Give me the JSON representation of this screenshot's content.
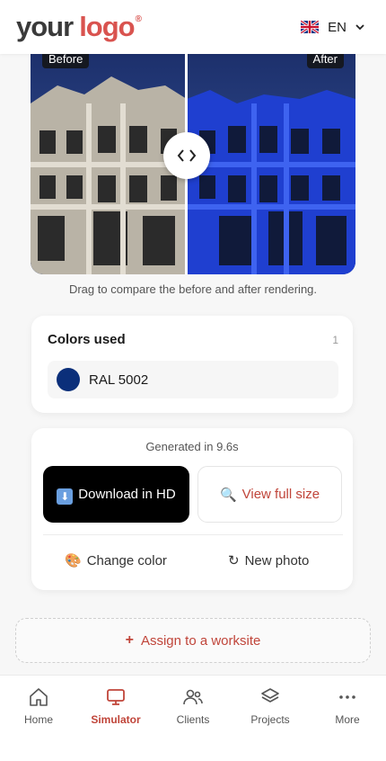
{
  "header": {
    "logo_your": "your",
    "logo_word": "logo",
    "logo_reg": "®",
    "language": "EN"
  },
  "compare": {
    "before_label": "Before",
    "after_label": "After",
    "hint": "Drag to compare the before and after rendering."
  },
  "colors": {
    "title": "Colors used",
    "count": "1",
    "items": [
      {
        "name": "RAL 5002",
        "color": "#0b2f7a"
      }
    ]
  },
  "result": {
    "generated": "Generated in 9.6s",
    "download_label": "Download in HD",
    "view_label": "View full size",
    "change_color_label": "Change color",
    "new_photo_label": "New photo"
  },
  "assign_label": "Assign to a worksite",
  "nav": {
    "items": [
      {
        "label": "Home",
        "icon": "home-icon"
      },
      {
        "label": "Simulator",
        "icon": "monitor-icon"
      },
      {
        "label": "Clients",
        "icon": "users-icon"
      },
      {
        "label": "Projects",
        "icon": "layers-icon"
      },
      {
        "label": "More",
        "icon": "more-dots-icon"
      }
    ],
    "active": "Simulator"
  },
  "colors_theme": {
    "accent": "#c0453a",
    "swatch": "#0b2f7a"
  }
}
